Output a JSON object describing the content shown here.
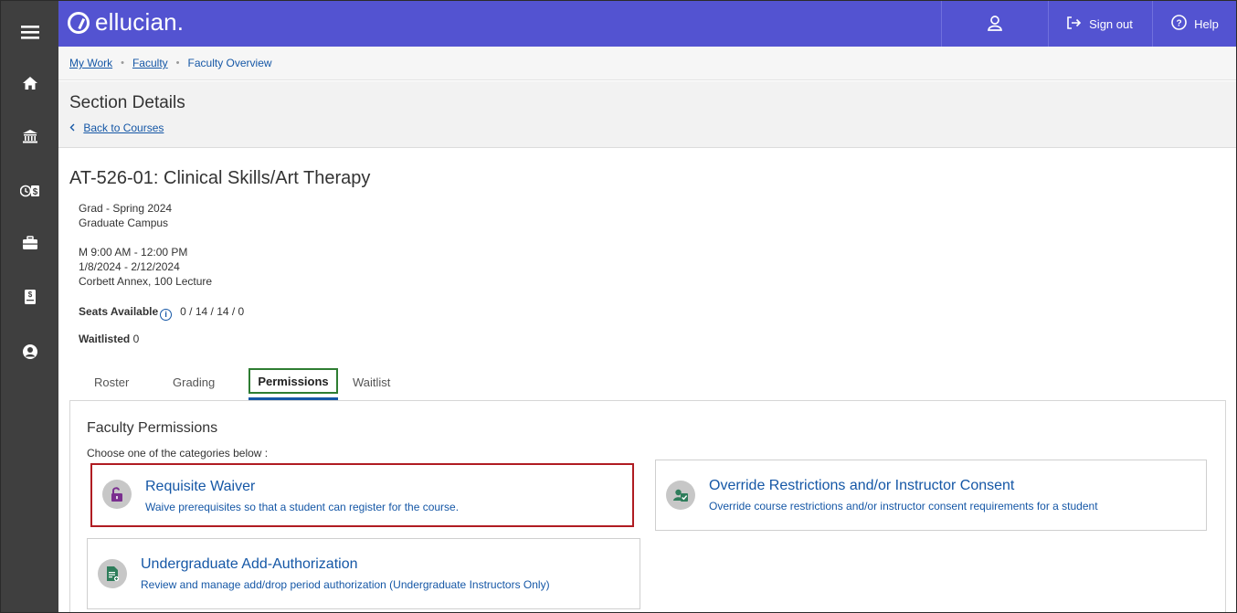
{
  "rail": {
    "icons": [
      "menu-icon",
      "home-icon",
      "institution-icon",
      "finance-icon",
      "briefcase-icon",
      "document-icon",
      "user-circle-icon"
    ]
  },
  "header": {
    "brand": "ellucian.",
    "sign_out": "Sign out",
    "help": "Help"
  },
  "breadcrumb": {
    "items": [
      "My Work",
      "Faculty",
      "Faculty Overview"
    ]
  },
  "page": {
    "title": "Section Details",
    "back_link": "Back to Courses"
  },
  "section": {
    "title": "AT-526-01: Clinical Skills/Art Therapy",
    "term": "Grad - Spring 2024",
    "location": "Graduate Campus",
    "meeting_time": "M 9:00 AM - 12:00 PM",
    "dates": "1/8/2024 - 2/12/2024",
    "room": "Corbett Annex, 100 Lecture",
    "seats_label": "Seats Available",
    "seats_value": "0 / 14 / 14 / 0",
    "waitlisted_label": "Waitlisted",
    "waitlisted_value": "0"
  },
  "tabs": {
    "roster": "Roster",
    "grading": "Grading",
    "permissions": "Permissions",
    "waitlist": "Waitlist",
    "active": "Permissions"
  },
  "permissions": {
    "heading": "Faculty Permissions",
    "hint": "Choose one of the categories below :",
    "cards": [
      {
        "title": "Requisite Waiver",
        "description": "Waive prerequisites so that a student can register for the course.",
        "icon": "unlock-icon"
      },
      {
        "title": "Override Restrictions and/or Instructor Consent",
        "description": "Override course restrictions and/or instructor consent requirements for a student",
        "icon": "user-check-icon"
      },
      {
        "title": "Undergraduate Add-Authorization",
        "description": "Review and manage add/drop period authorization (Undergraduate Instructors Only)",
        "icon": "document-add-icon"
      }
    ]
  },
  "colors": {
    "header": "#5353d1",
    "rail": "#3f3f3f",
    "link": "#1557a6",
    "highlight_green": "#2e7d32",
    "highlight_red": "#b01c22"
  }
}
